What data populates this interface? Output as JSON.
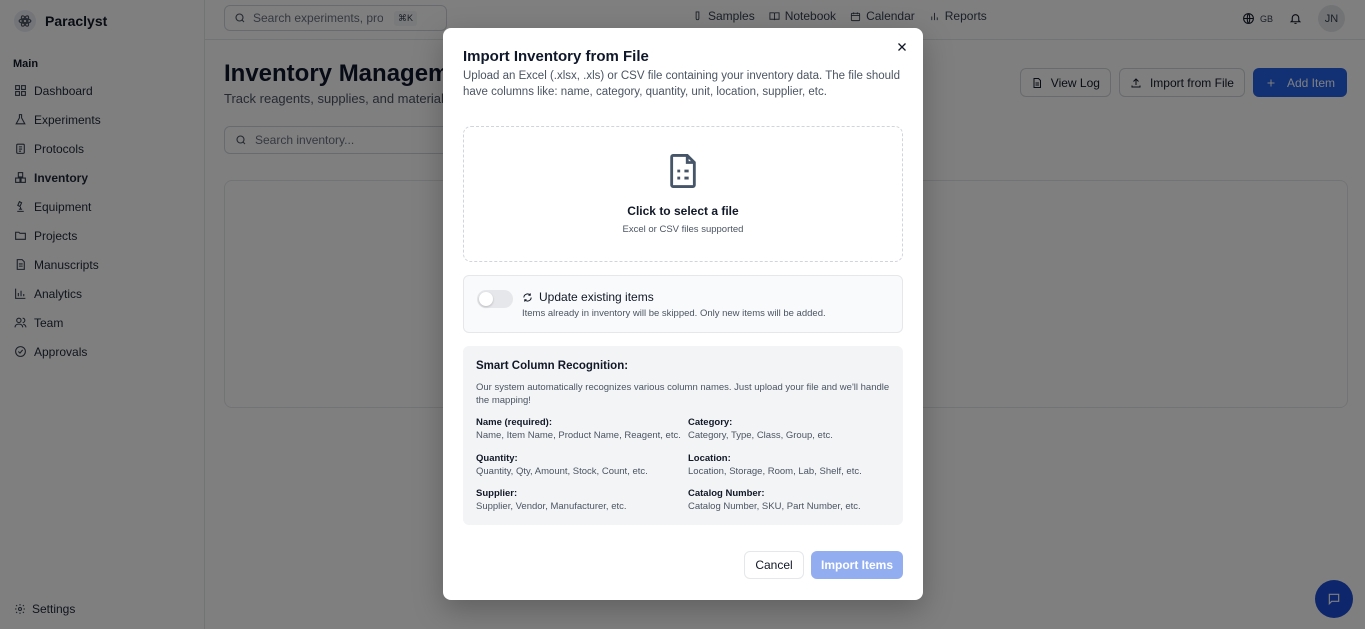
{
  "app": {
    "name": "Paraclyst"
  },
  "sidebar": {
    "section_label": "Main",
    "items": [
      {
        "label": "Dashboard",
        "icon": "grid-icon"
      },
      {
        "label": "Experiments",
        "icon": "flask-icon"
      },
      {
        "label": "Protocols",
        "icon": "clipboard-icon"
      },
      {
        "label": "Inventory",
        "icon": "boxes-icon",
        "active": true
      },
      {
        "label": "Equipment",
        "icon": "microscope-icon"
      },
      {
        "label": "Projects",
        "icon": "folder-icon"
      },
      {
        "label": "Manuscripts",
        "icon": "document-icon"
      },
      {
        "label": "Analytics",
        "icon": "bar-chart-icon"
      },
      {
        "label": "Team",
        "icon": "users-icon"
      },
      {
        "label": "Approvals",
        "icon": "check-circle-icon"
      }
    ],
    "settings_label": "Settings"
  },
  "topbar": {
    "search_placeholder": "Search experiments, protocols...",
    "shortcut": "⌘K",
    "nav": [
      {
        "label": "Samples",
        "icon": "test-tube-icon"
      },
      {
        "label": "Notebook",
        "icon": "book-icon"
      },
      {
        "label": "Calendar",
        "icon": "calendar-icon"
      },
      {
        "label": "Reports",
        "icon": "reports-icon"
      }
    ],
    "language": "GB",
    "avatar_initials": "JN"
  },
  "main": {
    "title": "Inventory Management",
    "subtitle": "Track reagents, supplies, and materials",
    "search_placeholder": "Search inventory...",
    "actions": {
      "view_log": "View Log",
      "import": "Import from File",
      "add": "Add Item"
    }
  },
  "modal": {
    "title": "Import Inventory from File",
    "description": "Upload an Excel (.xlsx, .xls) or CSV file containing your inventory data. The file should have columns like: name, category, quantity, unit, location, supplier, etc.",
    "dropzone": {
      "title": "Click to select a file",
      "subtitle": "Excel or CSV files supported"
    },
    "update_toggle": {
      "label": "Update existing items",
      "description": "Items already in inventory will be skipped. Only new items will be added.",
      "checked": false
    },
    "smart": {
      "title": "Smart Column Recognition:",
      "description": "Our system automatically recognizes various column names. Just upload your file and we'll handle the mapping!",
      "fields": [
        {
          "label": "Name (required):",
          "values": "Name, Item Name, Product Name, Reagent, etc."
        },
        {
          "label": "Category:",
          "values": "Category, Type, Class, Group, etc."
        },
        {
          "label": "Quantity:",
          "values": "Quantity, Qty, Amount, Stock, Count, etc."
        },
        {
          "label": "Location:",
          "values": "Location, Storage, Room, Lab, Shelf, etc."
        },
        {
          "label": "Supplier:",
          "values": "Supplier, Vendor, Manufacturer, etc."
        },
        {
          "label": "Catalog Number:",
          "values": "Catalog Number, SKU, Part Number, etc."
        }
      ]
    },
    "cancel_label": "Cancel",
    "import_label": "Import Items"
  },
  "colors": {
    "primary": "#2563eb",
    "primary_disabled": "#93aef0",
    "overlay": "rgba(0,0,0,0.5)"
  }
}
